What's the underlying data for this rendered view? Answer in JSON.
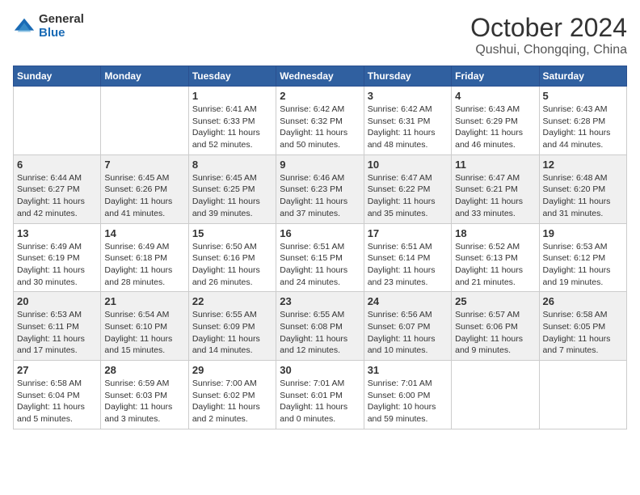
{
  "logo": {
    "general": "General",
    "blue": "Blue"
  },
  "title": "October 2024",
  "location": "Qushui, Chongqing, China",
  "days_of_week": [
    "Sunday",
    "Monday",
    "Tuesday",
    "Wednesday",
    "Thursday",
    "Friday",
    "Saturday"
  ],
  "weeks": [
    [
      {
        "day": "",
        "sunrise": "",
        "sunset": "",
        "daylight": ""
      },
      {
        "day": "",
        "sunrise": "",
        "sunset": "",
        "daylight": ""
      },
      {
        "day": "1",
        "sunrise": "Sunrise: 6:41 AM",
        "sunset": "Sunset: 6:33 PM",
        "daylight": "Daylight: 11 hours and 52 minutes."
      },
      {
        "day": "2",
        "sunrise": "Sunrise: 6:42 AM",
        "sunset": "Sunset: 6:32 PM",
        "daylight": "Daylight: 11 hours and 50 minutes."
      },
      {
        "day": "3",
        "sunrise": "Sunrise: 6:42 AM",
        "sunset": "Sunset: 6:31 PM",
        "daylight": "Daylight: 11 hours and 48 minutes."
      },
      {
        "day": "4",
        "sunrise": "Sunrise: 6:43 AM",
        "sunset": "Sunset: 6:29 PM",
        "daylight": "Daylight: 11 hours and 46 minutes."
      },
      {
        "day": "5",
        "sunrise": "Sunrise: 6:43 AM",
        "sunset": "Sunset: 6:28 PM",
        "daylight": "Daylight: 11 hours and 44 minutes."
      }
    ],
    [
      {
        "day": "6",
        "sunrise": "Sunrise: 6:44 AM",
        "sunset": "Sunset: 6:27 PM",
        "daylight": "Daylight: 11 hours and 42 minutes."
      },
      {
        "day": "7",
        "sunrise": "Sunrise: 6:45 AM",
        "sunset": "Sunset: 6:26 PM",
        "daylight": "Daylight: 11 hours and 41 minutes."
      },
      {
        "day": "8",
        "sunrise": "Sunrise: 6:45 AM",
        "sunset": "Sunset: 6:25 PM",
        "daylight": "Daylight: 11 hours and 39 minutes."
      },
      {
        "day": "9",
        "sunrise": "Sunrise: 6:46 AM",
        "sunset": "Sunset: 6:23 PM",
        "daylight": "Daylight: 11 hours and 37 minutes."
      },
      {
        "day": "10",
        "sunrise": "Sunrise: 6:47 AM",
        "sunset": "Sunset: 6:22 PM",
        "daylight": "Daylight: 11 hours and 35 minutes."
      },
      {
        "day": "11",
        "sunrise": "Sunrise: 6:47 AM",
        "sunset": "Sunset: 6:21 PM",
        "daylight": "Daylight: 11 hours and 33 minutes."
      },
      {
        "day": "12",
        "sunrise": "Sunrise: 6:48 AM",
        "sunset": "Sunset: 6:20 PM",
        "daylight": "Daylight: 11 hours and 31 minutes."
      }
    ],
    [
      {
        "day": "13",
        "sunrise": "Sunrise: 6:49 AM",
        "sunset": "Sunset: 6:19 PM",
        "daylight": "Daylight: 11 hours and 30 minutes."
      },
      {
        "day": "14",
        "sunrise": "Sunrise: 6:49 AM",
        "sunset": "Sunset: 6:18 PM",
        "daylight": "Daylight: 11 hours and 28 minutes."
      },
      {
        "day": "15",
        "sunrise": "Sunrise: 6:50 AM",
        "sunset": "Sunset: 6:16 PM",
        "daylight": "Daylight: 11 hours and 26 minutes."
      },
      {
        "day": "16",
        "sunrise": "Sunrise: 6:51 AM",
        "sunset": "Sunset: 6:15 PM",
        "daylight": "Daylight: 11 hours and 24 minutes."
      },
      {
        "day": "17",
        "sunrise": "Sunrise: 6:51 AM",
        "sunset": "Sunset: 6:14 PM",
        "daylight": "Daylight: 11 hours and 23 minutes."
      },
      {
        "day": "18",
        "sunrise": "Sunrise: 6:52 AM",
        "sunset": "Sunset: 6:13 PM",
        "daylight": "Daylight: 11 hours and 21 minutes."
      },
      {
        "day": "19",
        "sunrise": "Sunrise: 6:53 AM",
        "sunset": "Sunset: 6:12 PM",
        "daylight": "Daylight: 11 hours and 19 minutes."
      }
    ],
    [
      {
        "day": "20",
        "sunrise": "Sunrise: 6:53 AM",
        "sunset": "Sunset: 6:11 PM",
        "daylight": "Daylight: 11 hours and 17 minutes."
      },
      {
        "day": "21",
        "sunrise": "Sunrise: 6:54 AM",
        "sunset": "Sunset: 6:10 PM",
        "daylight": "Daylight: 11 hours and 15 minutes."
      },
      {
        "day": "22",
        "sunrise": "Sunrise: 6:55 AM",
        "sunset": "Sunset: 6:09 PM",
        "daylight": "Daylight: 11 hours and 14 minutes."
      },
      {
        "day": "23",
        "sunrise": "Sunrise: 6:55 AM",
        "sunset": "Sunset: 6:08 PM",
        "daylight": "Daylight: 11 hours and 12 minutes."
      },
      {
        "day": "24",
        "sunrise": "Sunrise: 6:56 AM",
        "sunset": "Sunset: 6:07 PM",
        "daylight": "Daylight: 11 hours and 10 minutes."
      },
      {
        "day": "25",
        "sunrise": "Sunrise: 6:57 AM",
        "sunset": "Sunset: 6:06 PM",
        "daylight": "Daylight: 11 hours and 9 minutes."
      },
      {
        "day": "26",
        "sunrise": "Sunrise: 6:58 AM",
        "sunset": "Sunset: 6:05 PM",
        "daylight": "Daylight: 11 hours and 7 minutes."
      }
    ],
    [
      {
        "day": "27",
        "sunrise": "Sunrise: 6:58 AM",
        "sunset": "Sunset: 6:04 PM",
        "daylight": "Daylight: 11 hours and 5 minutes."
      },
      {
        "day": "28",
        "sunrise": "Sunrise: 6:59 AM",
        "sunset": "Sunset: 6:03 PM",
        "daylight": "Daylight: 11 hours and 3 minutes."
      },
      {
        "day": "29",
        "sunrise": "Sunrise: 7:00 AM",
        "sunset": "Sunset: 6:02 PM",
        "daylight": "Daylight: 11 hours and 2 minutes."
      },
      {
        "day": "30",
        "sunrise": "Sunrise: 7:01 AM",
        "sunset": "Sunset: 6:01 PM",
        "daylight": "Daylight: 11 hours and 0 minutes."
      },
      {
        "day": "31",
        "sunrise": "Sunrise: 7:01 AM",
        "sunset": "Sunset: 6:00 PM",
        "daylight": "Daylight: 10 hours and 59 minutes."
      },
      {
        "day": "",
        "sunrise": "",
        "sunset": "",
        "daylight": ""
      },
      {
        "day": "",
        "sunrise": "",
        "sunset": "",
        "daylight": ""
      }
    ]
  ]
}
